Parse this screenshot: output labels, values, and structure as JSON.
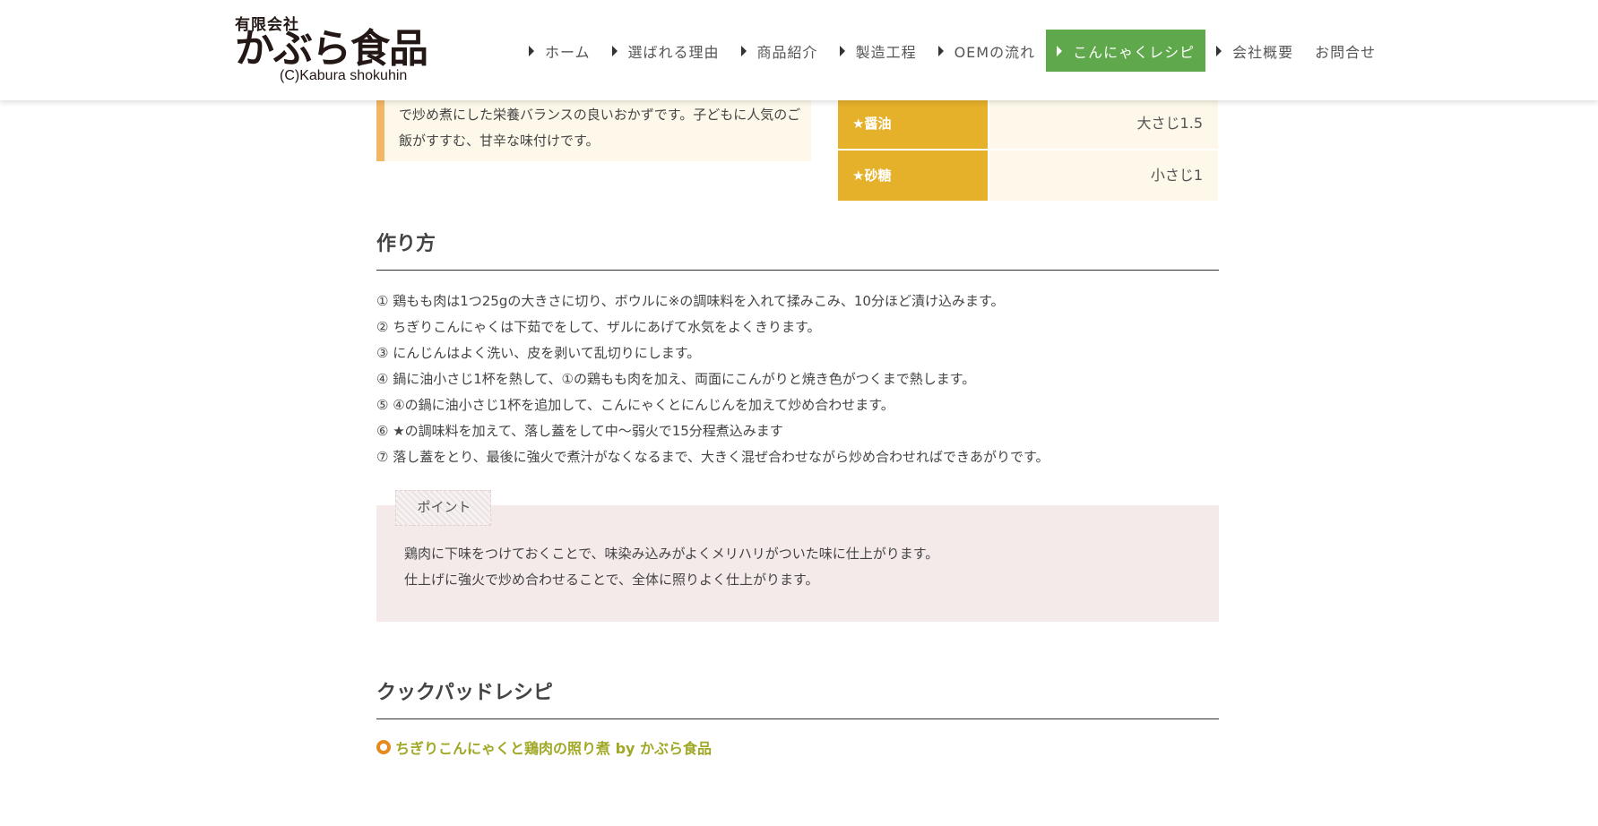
{
  "header": {
    "logo": {
      "company_type": "有限会社",
      "name": "かぶら食品",
      "copyright": "(C)Kabura shokuhin"
    },
    "nav": [
      {
        "label": "ホーム"
      },
      {
        "label": "選ばれる理由"
      },
      {
        "label": "商品紹介"
      },
      {
        "label": "製造工程"
      },
      {
        "label": "OEMの流れ"
      },
      {
        "label": "こんにゃくレシピ",
        "active": true
      },
      {
        "label": "会社概要"
      },
      {
        "label": "お問合せ"
      }
    ]
  },
  "intro": {
    "text": "で炒め煮にした栄養バランスの良いおかずです。子どもに人気のご\n飯がすすむ、甘辛な味付けです。"
  },
  "ingredients": [
    {
      "name": "★醤油",
      "amount": "大さじ1.5"
    },
    {
      "name": "★砂糖",
      "amount": "小さじ1"
    }
  ],
  "method": {
    "title": "作り方",
    "steps": [
      "① 鶏もも肉は1つ25gの大きさに切り、ボウルに※の調味料を入れて揉みこみ、10分ほど漬け込みます。",
      "② ちぎりこんにゃくは下茹でをして、ザルにあげて水気をよくきります。",
      "③ にんじんはよく洗い、皮を剥いて乱切りにします。",
      "④ 鍋に油小さじ1杯を熱して、①の鶏もも肉を加え、両面にこんがりと焼き色がつくまで熱します。",
      "⑤ ④の鍋に油小さじ1杯を追加して、こんにゃくとにんじんを加えて炒め合わせます。",
      "⑥ ★の調味料を加えて、落し蓋をして中〜弱火で15分程煮込みます",
      "⑦ 落し蓋をとり、最後に強火で煮汁がなくなるまで、大きく混ぜ合わせながら炒め合わせればできあがりです。"
    ]
  },
  "point": {
    "label": "ポイント",
    "text": "鶏肉に下味をつけておくことで、味染み込みがよくメリハリがついた味に仕上がります。\n仕上げに強火で炒め合わせることで、全体に照りよく仕上がります。"
  },
  "cookpad": {
    "title": "クックパッドレシピ",
    "link_text": "ちぎりこんにゃくと鶏肉の照り煮 by かぶら食品"
  },
  "colors": {
    "nav_active": "#5fa84b",
    "ingredient_label": "#e6b12a",
    "intro_bar": "#f2b764",
    "point_bg": "#f5eaea",
    "link": "#a0a825"
  }
}
